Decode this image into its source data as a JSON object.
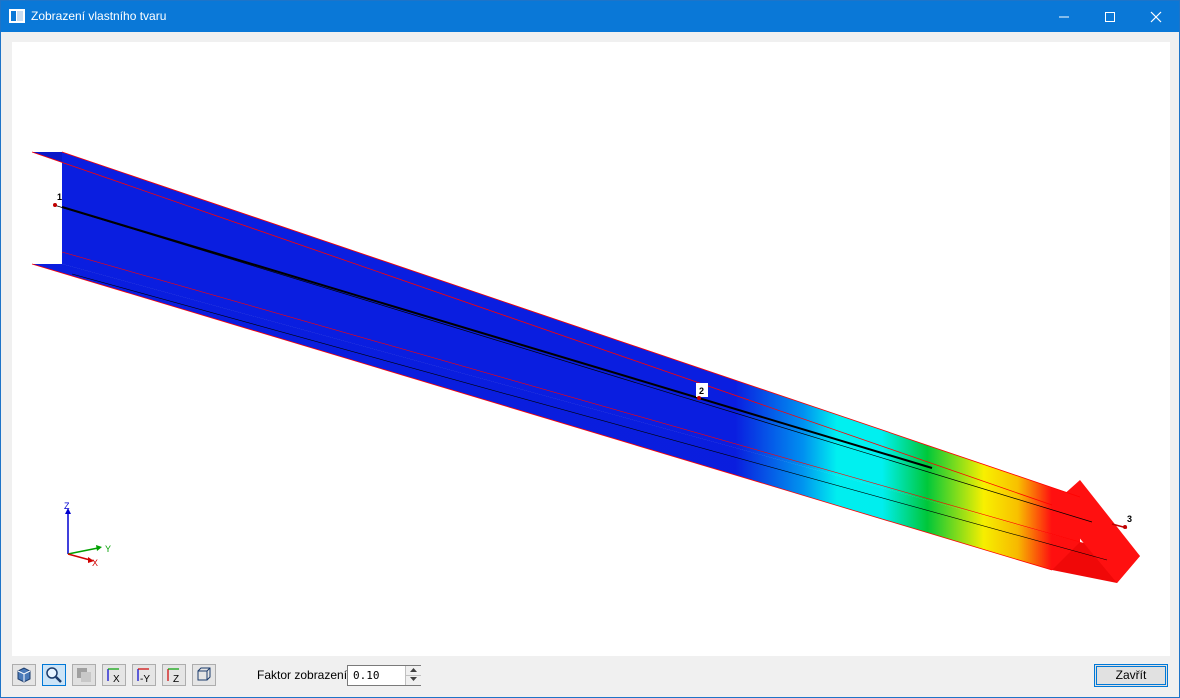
{
  "window": {
    "title": "Zobrazení vlastního tvaru",
    "icon": "window-app-icon",
    "controls": [
      "minimize-icon",
      "maximize-icon",
      "close-icon"
    ]
  },
  "viewport": {
    "nodes": [
      {
        "label": "1"
      },
      {
        "label": "2"
      },
      {
        "label": "3"
      }
    ],
    "axes": {
      "z": "Z",
      "y": "Y",
      "x": "X"
    },
    "colors": {
      "blue": "#0a1ee0",
      "cyan": "#00f0f0",
      "green": "#00c83a",
      "yellow": "#f8f000",
      "red": "#ff1010",
      "edge": "#ff0000"
    }
  },
  "toolbar": {
    "buttons": [
      {
        "name": "view-3d-icon"
      },
      {
        "name": "zoom-icon"
      },
      {
        "name": "render-mode-icon"
      },
      {
        "name": "view-x-icon",
        "label": "X"
      },
      {
        "name": "view-minus-y-icon",
        "label": "-Y"
      },
      {
        "name": "view-z-icon",
        "label": "Z"
      },
      {
        "name": "view-iso-icon"
      }
    ],
    "factor_label": "Faktor zobrazení:",
    "factor_value": "0.10",
    "close_label": "Zavřít"
  }
}
